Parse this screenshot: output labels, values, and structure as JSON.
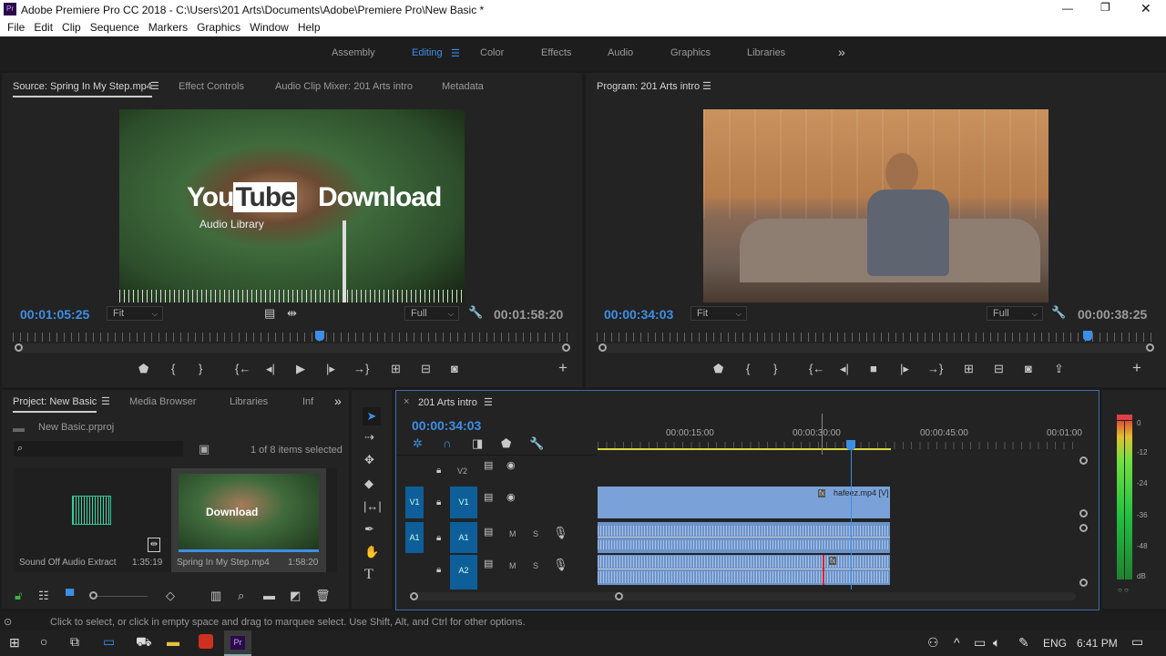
{
  "window": {
    "title": "Adobe Premiere Pro CC 2018 - C:\\Users\\201 Arts\\Documents\\Adobe\\Premiere Pro\\New Basic *",
    "app_icon": "Pr"
  },
  "menu": [
    "File",
    "Edit",
    "Clip",
    "Sequence",
    "Markers",
    "Graphics",
    "Window",
    "Help"
  ],
  "workspaces": {
    "items": [
      "Assembly",
      "Editing",
      "Color",
      "Effects",
      "Audio",
      "Graphics",
      "Libraries"
    ],
    "active": "Editing",
    "more": "»"
  },
  "source": {
    "tabs": [
      "Source: Spring In My Step.mp4",
      "Effect Controls",
      "Audio Clip Mixer: 201 Arts intro",
      "Metadata"
    ],
    "video_text": {
      "brand1": "You",
      "brand2": "Tube",
      "brand3": "Download",
      "sub": "Audio Library"
    },
    "timecode": "00:01:05:25",
    "fit": "Fit",
    "resolution": "Full",
    "duration": "00:01:58:20",
    "playhead_fraction": 0.55
  },
  "program": {
    "tab": "Program: 201 Arts intro",
    "timecode": "00:00:34:03",
    "fit": "Fit",
    "resolution": "Full",
    "duration": "00:00:38:25",
    "playhead_fraction": 0.88
  },
  "project": {
    "tabs": [
      "Project: New Basic",
      "Media Browser",
      "Libraries",
      "Inf"
    ],
    "file": "New Basic.prproj",
    "status": "1 of 8 items selected",
    "items": [
      {
        "name": "Sound Off Audio Extract",
        "duration": "1:35:19"
      },
      {
        "name": "Spring In My Step.mp4",
        "duration": "1:58:20"
      }
    ]
  },
  "timeline": {
    "tab": "201 Arts intro",
    "timecode": "00:00:34:03",
    "ruler": [
      "00:00:15:00",
      "00:00:30:00",
      "00:00:45:00",
      "00:01:00"
    ],
    "tracks": {
      "v2": "V2",
      "v1": "V1",
      "a1": "A1",
      "a2": "A2",
      "m": "M",
      "s": "S"
    },
    "clip": "hafeez.mp4 [V]",
    "fx": "fx"
  },
  "meters": {
    "labels": [
      "0",
      "-12",
      "-24",
      "-36",
      "-48",
      "dB"
    ],
    "solo": "○ ○"
  },
  "status_bar": "Click to select, or click in empty space and drag to marquee select. Use Shift, Alt, and Ctrl for other options.",
  "taskbar": {
    "lang": "ENG",
    "time": "6:41 PM"
  },
  "colors": {
    "accent": "#3d8fe6",
    "panel": "#232323",
    "clip": "#7aa2d8"
  }
}
